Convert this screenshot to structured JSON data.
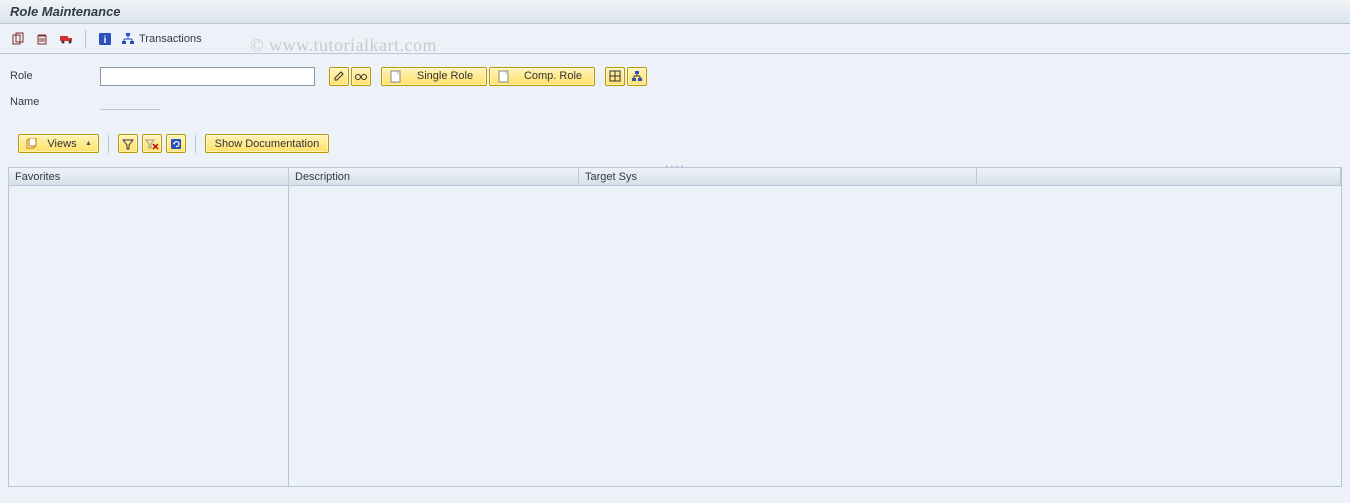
{
  "title": "Role Maintenance",
  "app_toolbar": {
    "copy_icon": "copy",
    "delete_icon": "delete",
    "transport_icon": "transport",
    "info_icon": "info",
    "transactions_label": "Transactions"
  },
  "form": {
    "role_label": "Role",
    "role_value": "",
    "name_label": "Name",
    "name_value": ""
  },
  "action_buttons": {
    "change_icon": "pencil",
    "display_icon": "glasses",
    "single_role_label": "Single Role",
    "comp_role_label": "Comp. Role",
    "variant_icon": "variant",
    "assign_icon": "assign"
  },
  "gallery_toolbar": {
    "views_label": "Views",
    "filter_icon": "filter",
    "delete_filter_icon": "delete-filter",
    "refresh_icon": "refresh",
    "doc_label": "Show Documentation"
  },
  "grid": {
    "col_favorites": "Favorites",
    "col_description": "Description",
    "col_target": "Target Sys"
  },
  "watermark": "© www.tutorialkart.com"
}
